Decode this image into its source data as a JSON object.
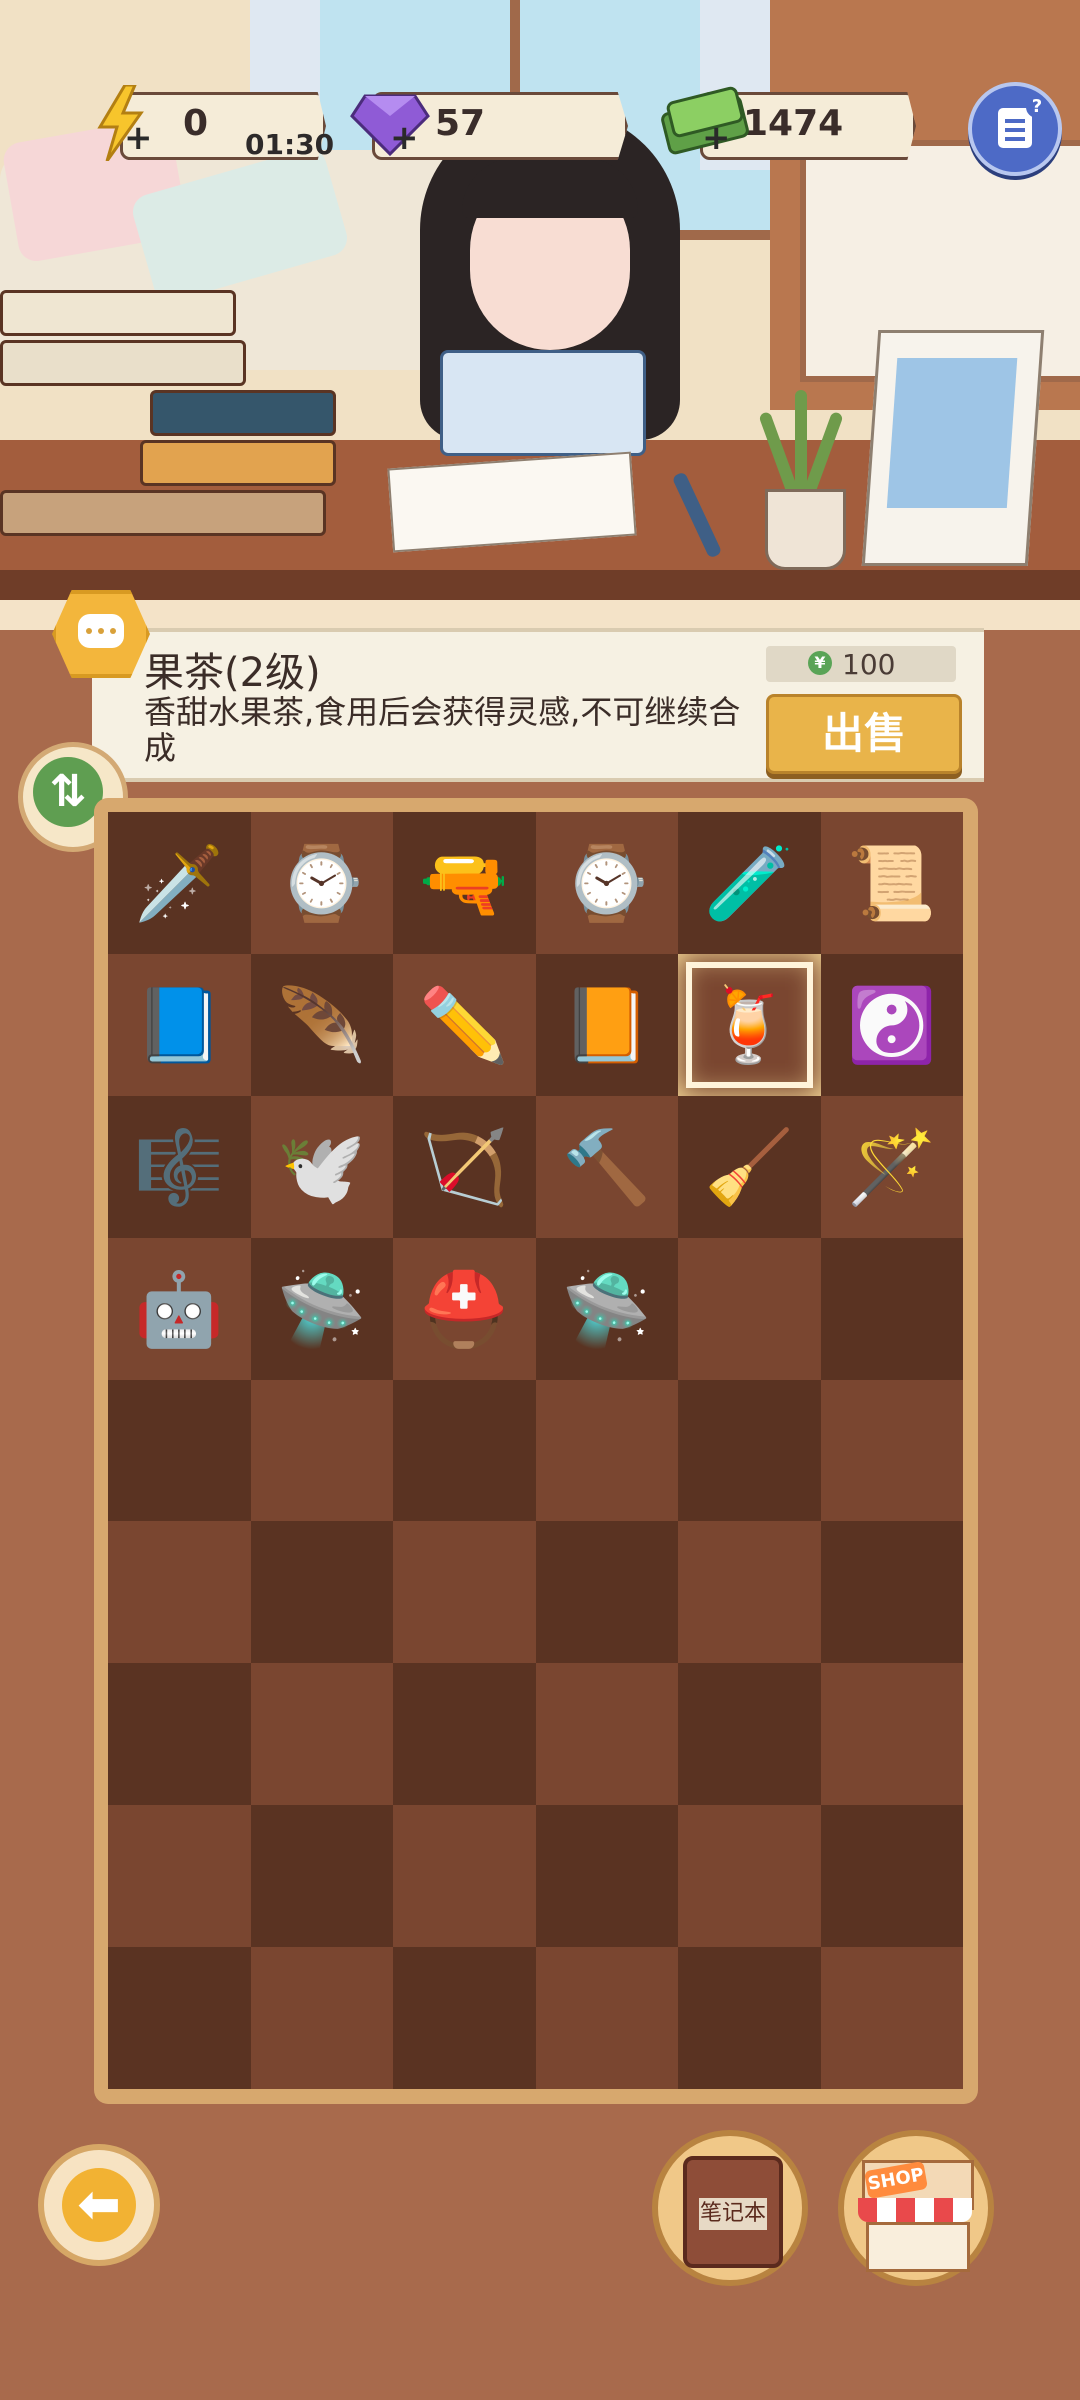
{
  "status_bar": {
    "energy": {
      "value": "0",
      "timer": "01:30",
      "plus": "+"
    },
    "gems": {
      "value": "57",
      "plus": "+"
    },
    "cash": {
      "value": "1474",
      "plus": "+"
    }
  },
  "item_info": {
    "title": "果茶(2级)",
    "description": "香甜水果茶,食用后会获得灵感,不可继续合成",
    "price": "100",
    "price_currency_symbol": "¥",
    "sell_label": "出售"
  },
  "inventory": {
    "rows": 9,
    "cols": 6,
    "selected_index": 10,
    "items": [
      {
        "name": "sword",
        "icon": "🗡️"
      },
      {
        "name": "wristwatch",
        "icon": "⌚"
      },
      {
        "name": "pistol",
        "icon": "🔫"
      },
      {
        "name": "digital-watch",
        "icon": "⌚"
      },
      {
        "name": "potion",
        "icon": "🧪"
      },
      {
        "name": "scroll",
        "icon": "📜"
      },
      {
        "name": "ancient-book",
        "icon": "📘"
      },
      {
        "name": "feather-fan",
        "icon": "🪶"
      },
      {
        "name": "pencil",
        "icon": "✏️"
      },
      {
        "name": "exam-book",
        "icon": "📙"
      },
      {
        "name": "fruit-tea",
        "icon": "🍹"
      },
      {
        "name": "bagua-mirror",
        "icon": "☯️"
      },
      {
        "name": "lyre",
        "icon": "🎼"
      },
      {
        "name": "angel-wings",
        "icon": "🕊️"
      },
      {
        "name": "bow-arrow",
        "icon": "🏹"
      },
      {
        "name": "hammer",
        "icon": "🔨"
      },
      {
        "name": "broom",
        "icon": "🧹"
      },
      {
        "name": "magic-staff",
        "icon": "🪄"
      },
      {
        "name": "robot",
        "icon": "🤖"
      },
      {
        "name": "drone",
        "icon": "🛸"
      },
      {
        "name": "viking-helmet",
        "icon": "⛑️"
      },
      {
        "name": "ufo",
        "icon": "🛸"
      }
    ]
  },
  "bottom_bar": {
    "notebook_label": "笔记本",
    "shop_label": "SHOP"
  },
  "icons": {
    "back": "⬅",
    "sort": "⇅"
  }
}
